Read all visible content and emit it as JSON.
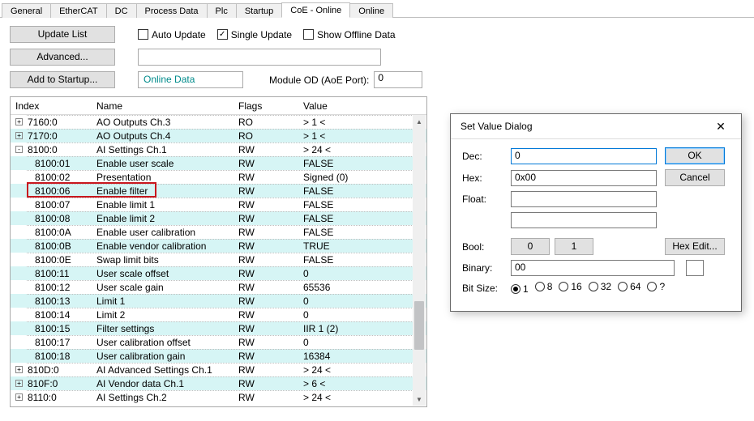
{
  "tabs": [
    "General",
    "EtherCAT",
    "DC",
    "Process Data",
    "Plc",
    "Startup",
    "CoE - Online",
    "Online"
  ],
  "active_tab": "CoE - Online",
  "buttons": {
    "update_list": "Update List",
    "advanced": "Advanced...",
    "add_startup": "Add to Startup..."
  },
  "checkboxes": {
    "auto_update": {
      "label": "Auto Update",
      "checked": false
    },
    "single_update": {
      "label": "Single Update",
      "checked": true
    },
    "show_offline": {
      "label": "Show Offline Data",
      "checked": false
    }
  },
  "online_data_label": "Online Data",
  "module_od_label": "Module OD (AoE Port):",
  "module_od_value": "0",
  "table": {
    "headers": [
      "Index",
      "Name",
      "Flags",
      "Value"
    ],
    "rows": [
      {
        "idx": "7160:0",
        "name": "AO Outputs Ch.3",
        "flags": "RO",
        "val": "> 1 <",
        "tog": "+",
        "level": 0,
        "alt": false
      },
      {
        "idx": "7170:0",
        "name": "AO Outputs Ch.4",
        "flags": "RO",
        "val": "> 1 <",
        "tog": "+",
        "level": 0,
        "alt": true
      },
      {
        "idx": "8100:0",
        "name": "AI Settings Ch.1",
        "flags": "RW",
        "val": "> 24 <",
        "tog": "-",
        "level": 0,
        "alt": false
      },
      {
        "idx": "8100:01",
        "name": "Enable user scale",
        "flags": "RW",
        "val": "FALSE",
        "level": 1,
        "alt": true
      },
      {
        "idx": "8100:02",
        "name": "Presentation",
        "flags": "RW",
        "val": "Signed (0)",
        "level": 1,
        "alt": false
      },
      {
        "idx": "8100:06",
        "name": "Enable filter",
        "flags": "RW",
        "val": "FALSE",
        "level": 1,
        "alt": true,
        "hl": true
      },
      {
        "idx": "8100:07",
        "name": "Enable limit 1",
        "flags": "RW",
        "val": "FALSE",
        "level": 1,
        "alt": false
      },
      {
        "idx": "8100:08",
        "name": "Enable limit 2",
        "flags": "RW",
        "val": "FALSE",
        "level": 1,
        "alt": true
      },
      {
        "idx": "8100:0A",
        "name": "Enable user calibration",
        "flags": "RW",
        "val": "FALSE",
        "level": 1,
        "alt": false
      },
      {
        "idx": "8100:0B",
        "name": "Enable vendor calibration",
        "flags": "RW",
        "val": "TRUE",
        "level": 1,
        "alt": true
      },
      {
        "idx": "8100:0E",
        "name": "Swap limit bits",
        "flags": "RW",
        "val": "FALSE",
        "level": 1,
        "alt": false
      },
      {
        "idx": "8100:11",
        "name": "User scale offset",
        "flags": "RW",
        "val": "0",
        "level": 1,
        "alt": true
      },
      {
        "idx": "8100:12",
        "name": "User scale gain",
        "flags": "RW",
        "val": "65536",
        "level": 1,
        "alt": false
      },
      {
        "idx": "8100:13",
        "name": "Limit 1",
        "flags": "RW",
        "val": "0",
        "level": 1,
        "alt": true
      },
      {
        "idx": "8100:14",
        "name": "Limit 2",
        "flags": "RW",
        "val": "0",
        "level": 1,
        "alt": false
      },
      {
        "idx": "8100:15",
        "name": "Filter settings",
        "flags": "RW",
        "val": "IIR 1 (2)",
        "level": 1,
        "alt": true
      },
      {
        "idx": "8100:17",
        "name": "User calibration offset",
        "flags": "RW",
        "val": "0",
        "level": 1,
        "alt": false
      },
      {
        "idx": "8100:18",
        "name": "User calibration gain",
        "flags": "RW",
        "val": "16384",
        "level": 1,
        "alt": true
      },
      {
        "idx": "810D:0",
        "name": "AI Advanced Settings Ch.1",
        "flags": "RW",
        "val": "> 24 <",
        "tog": "+",
        "level": 0,
        "alt": false
      },
      {
        "idx": "810F:0",
        "name": "AI Vendor data Ch.1",
        "flags": "RW",
        "val": "> 6 <",
        "tog": "+",
        "level": 0,
        "alt": true
      },
      {
        "idx": "8110:0",
        "name": "AI Settings Ch.2",
        "flags": "RW",
        "val": "> 24 <",
        "tog": "+",
        "level": 0,
        "alt": false
      }
    ]
  },
  "dialog": {
    "title": "Set Value Dialog",
    "labels": {
      "dec": "Dec:",
      "hex": "Hex:",
      "float": "Float:",
      "bool": "Bool:",
      "binary": "Binary:",
      "bitsize": "Bit Size:"
    },
    "values": {
      "dec": "0",
      "hex": "0x00",
      "float": "",
      "binary": "00"
    },
    "buttons": {
      "ok": "OK",
      "cancel": "Cancel",
      "hexedit": "Hex Edit...",
      "b0": "0",
      "b1": "1"
    },
    "bitsize": {
      "options": [
        "1",
        "8",
        "16",
        "32",
        "64",
        "?"
      ],
      "selected": "1"
    }
  }
}
